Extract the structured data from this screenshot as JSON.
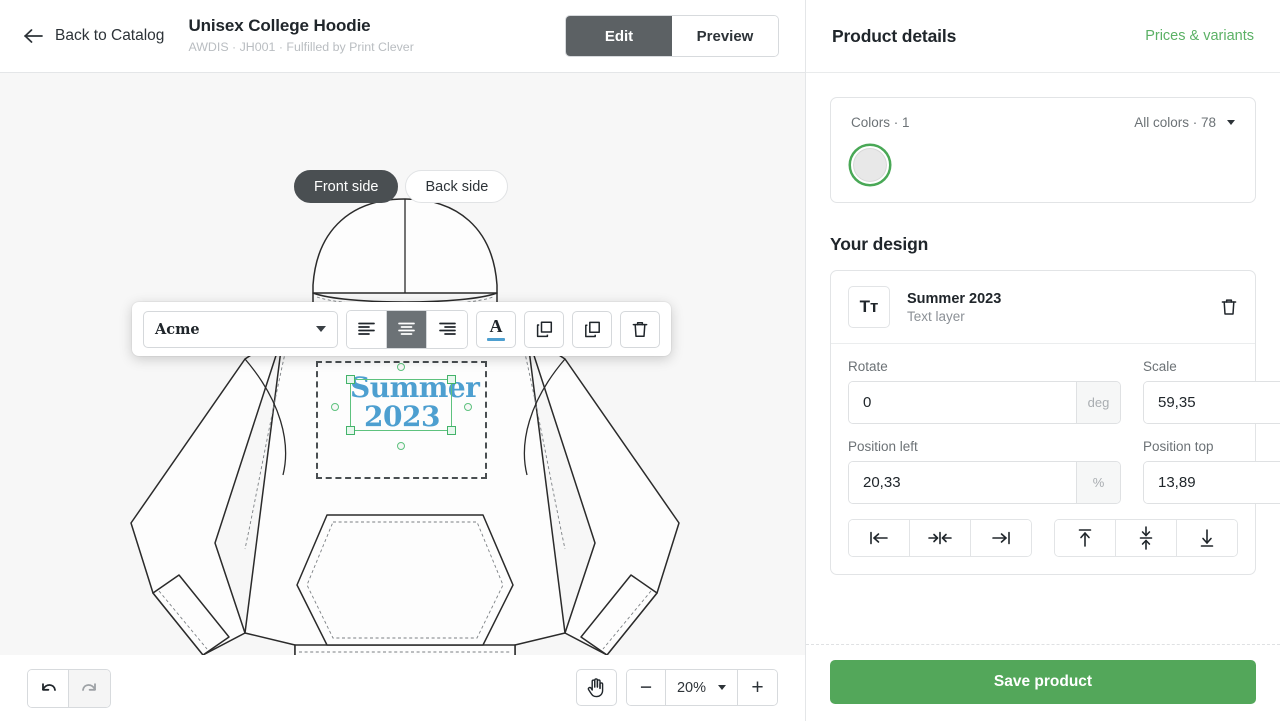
{
  "header": {
    "back_label": "Back to Catalog",
    "back_icon": "arrow-left-icon",
    "product_title": "Unisex College Hoodie",
    "product_subtitle": "AWDIS · JH001 · Fulfilled by Print Clever",
    "mode_tabs": [
      {
        "label": "Edit",
        "active": true
      },
      {
        "label": "Preview",
        "active": false
      }
    ]
  },
  "canvas": {
    "side_tabs": [
      {
        "label": "Front side",
        "active": true
      },
      {
        "label": "Back side",
        "active": false
      }
    ],
    "design_text_line1": "Summer",
    "design_text_line2": "2023",
    "design_text_color": "#4d9fd0",
    "selection_color": "#5ec27e",
    "background": "#f7f7f7"
  },
  "text_toolbar": {
    "font_value": "Acme",
    "font_caret_icon": "chevron-down-icon",
    "align_buttons": [
      {
        "name": "align-left",
        "icon": "align-left-icon",
        "active": false
      },
      {
        "name": "align-center",
        "icon": "align-center-icon",
        "active": true
      },
      {
        "name": "align-right",
        "icon": "align-right-icon",
        "active": false
      }
    ],
    "text_color_icon": "text-color-icon",
    "text_color_swatch": "#4d9fd0",
    "layers_icon": "layers-icon",
    "duplicate_icon": "duplicate-icon",
    "delete_icon": "trash-icon"
  },
  "bottom_bar": {
    "undo_icon": "undo-icon",
    "redo_icon": "redo-icon",
    "redo_disabled": true,
    "hand_icon": "hand-icon",
    "zoom_out_label": "−",
    "zoom_in_label": "+",
    "zoom_value": "20%",
    "zoom_caret_icon": "chevron-down-icon"
  },
  "right_panel": {
    "title": "Product details",
    "prices_link": "Prices & variants",
    "colors": {
      "count_label": "Colors · 1",
      "all_colors_label": "All colors · 78",
      "caret_icon": "chevron-down-icon",
      "selected_swatch_color": "#e8e8e8",
      "selected_ring_color": "#49a856"
    },
    "design_section_title": "Your design",
    "layer": {
      "thumb_icon": "text-layer-icon",
      "thumb_glyph": "Tт",
      "name": "Summer 2023",
      "type": "Text layer",
      "delete_icon": "trash-icon"
    },
    "properties": {
      "rotate_label": "Rotate",
      "rotate_value": "0",
      "rotate_unit": "deg",
      "scale_label": "Scale",
      "scale_value": "59,35",
      "scale_unit": "%",
      "position_left_label": "Position left",
      "position_left_value": "20,33",
      "position_left_unit": "%",
      "position_top_label": "Position top",
      "position_top_value": "13,89",
      "position_top_unit": "%",
      "h_align": [
        {
          "name": "align-left-edge",
          "icon": "align-left-edge-icon"
        },
        {
          "name": "align-horizontal-center",
          "icon": "align-horizontal-center-icon"
        },
        {
          "name": "align-right-edge",
          "icon": "align-right-edge-icon"
        }
      ],
      "v_align": [
        {
          "name": "align-top-edge",
          "icon": "align-top-edge-icon"
        },
        {
          "name": "align-vertical-center",
          "icon": "align-vertical-center-icon"
        },
        {
          "name": "align-bottom-edge",
          "icon": "align-bottom-edge-icon"
        }
      ]
    },
    "save_button": "Save product",
    "save_button_color": "#53a75a"
  }
}
